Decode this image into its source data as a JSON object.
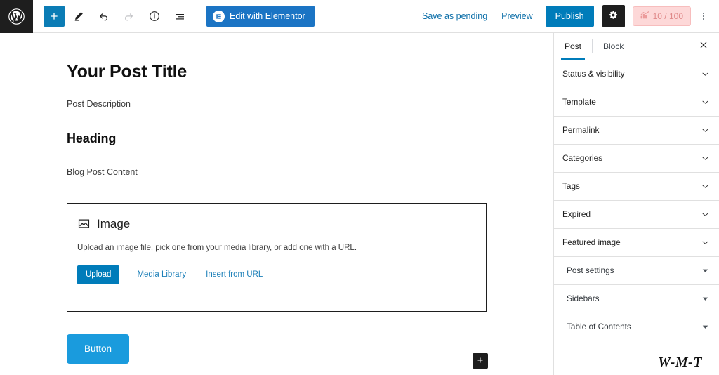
{
  "toolbar": {
    "wp_logo_name": "wordpress-logo",
    "add_block_label": "+",
    "tools": [
      {
        "name": "add-block-button",
        "icon": "plus-icon",
        "label": "Add block",
        "state": "primary"
      },
      {
        "name": "edit-mode-button",
        "icon": "pencil-icon",
        "label": "Tools",
        "state": "normal"
      },
      {
        "name": "undo-button",
        "icon": "undo-icon",
        "label": "Undo",
        "state": "normal"
      },
      {
        "name": "redo-button",
        "icon": "redo-icon",
        "label": "Redo",
        "state": "disabled"
      },
      {
        "name": "details-button",
        "icon": "info-circle-icon",
        "label": "Details",
        "state": "normal"
      },
      {
        "name": "list-view-button",
        "icon": "list-view-icon",
        "label": "List view",
        "state": "normal"
      }
    ],
    "elementor_label": "Edit with Elementor",
    "elementor_color": "#1b74c4",
    "save_pending_label": "Save as pending",
    "preview_label": "Preview",
    "publish_label": "Publish",
    "publish_color": "#007cba",
    "settings_icon": "gear-icon",
    "seo_badge": {
      "score": "10 / 100",
      "icon": "seo-signal-icon",
      "bg_color": "#fdd8d8",
      "text_color": "#e08a8a"
    },
    "more_menu_icon": "kebab-menu-icon"
  },
  "editor": {
    "post_title": "Your Post Title",
    "post_description": "Post Description",
    "heading": "Heading",
    "paragraph": "Blog Post Content",
    "image_block": {
      "icon": "image-placeholder-icon",
      "title": "Image",
      "description": "Upload an image file, pick one from your media library, or add one with a URL.",
      "upload_label": "Upload",
      "media_library_label": "Media Library",
      "insert_url_label": "Insert from URL",
      "upload_color": "#007cba"
    },
    "cta_button": {
      "label": "Button",
      "color": "#1a9bdd"
    },
    "block_appender_label": "+"
  },
  "sidebar": {
    "tabs": [
      {
        "label": "Post",
        "name": "tab-post",
        "active": true
      },
      {
        "label": "Block",
        "name": "tab-block",
        "active": false
      }
    ],
    "close_icon": "close-icon",
    "accent_color": "#007cba",
    "panels": [
      {
        "label": "Status & visibility",
        "name": "panel-status-visibility",
        "chevron": "chevron-down-icon",
        "group": "core"
      },
      {
        "label": "Template",
        "name": "panel-template",
        "chevron": "chevron-down-icon",
        "group": "core"
      },
      {
        "label": "Permalink",
        "name": "panel-permalink",
        "chevron": "chevron-down-icon",
        "group": "core"
      },
      {
        "label": "Categories",
        "name": "panel-categories",
        "chevron": "chevron-down-icon",
        "group": "core"
      },
      {
        "label": "Tags",
        "name": "panel-tags",
        "chevron": "chevron-down-icon",
        "group": "core"
      },
      {
        "label": "Expired",
        "name": "panel-expired",
        "chevron": "chevron-down-icon",
        "group": "core"
      },
      {
        "label": "Featured image",
        "name": "panel-featured-image",
        "chevron": "chevron-down-icon",
        "group": "core"
      },
      {
        "label": "Post settings",
        "name": "panel-post-settings",
        "chevron": "triangle-down-icon",
        "group": "plugin"
      },
      {
        "label": "Sidebars",
        "name": "panel-sidebars",
        "chevron": "triangle-down-icon",
        "group": "plugin"
      },
      {
        "label": "Table of Contents",
        "name": "panel-table-of-contents",
        "chevron": "triangle-down-icon",
        "group": "plugin"
      }
    ]
  },
  "watermark": {
    "text": "W-M-T"
  }
}
